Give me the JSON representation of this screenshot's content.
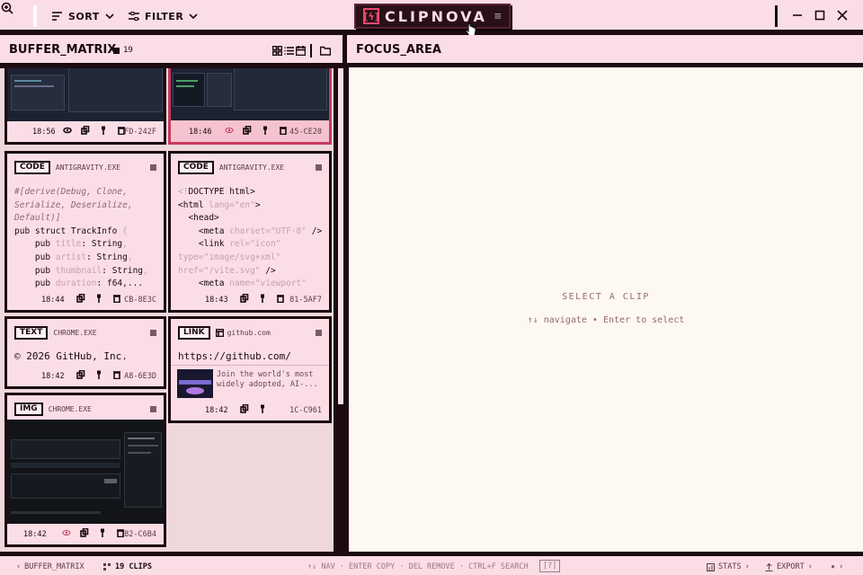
{
  "toolbar": {
    "sort_label": "SORT",
    "filter_label": "FILTER"
  },
  "logo": {
    "mark": "[ϟ]",
    "name": "CLIPNOVA"
  },
  "buffer": {
    "title": "BUFFER_MATRIX",
    "count": "19"
  },
  "focus": {
    "title": "FOCUS_AREA",
    "placeholder": "SELECT A CLIP",
    "hint": "↑↓ navigate • Enter to select"
  },
  "cards": [
    {
      "time": "18:56",
      "id": "FD-242F"
    },
    {
      "time": "18:46",
      "id": "45-CE20"
    },
    {
      "type": "CODE",
      "source": "ANTIGRAVITY.EXE",
      "time": "18:44",
      "id": "CB-8E3C"
    },
    {
      "type": "CODE",
      "source": "ANTIGRAVITY.EXE",
      "time": "18:43",
      "id": "81-5AF7"
    },
    {
      "type": "TEXT",
      "source": "CHROME.EXE",
      "content": "© 2026 GitHub, Inc.",
      "time": "18:42",
      "id": "A8-6E3D"
    },
    {
      "type": "LINK",
      "source": "github.com",
      "url": "https://github.com/",
      "preview": "Join the world's most widely adopted, AI-...",
      "time": "18:42",
      "id": "1C-C961"
    },
    {
      "type": "IMG",
      "source": "CHROME.EXE",
      "time": "18:42",
      "id": "B2-C6B4"
    }
  ],
  "rust_code": {
    "l1": "#[derive(Debug, Clone,",
    "l2": "Serialize, Deserialize,",
    "l3": "Default)]",
    "l4a": "pub struct TrackInfo ",
    "l4b": "{",
    "l5a": "    pub ",
    "l5b": "title",
    "l5c": ": String",
    "l5d": ",",
    "l6a": "    pub ",
    "l6b": "artist",
    "l6c": ": String",
    "l6d": ",",
    "l7a": "    pub ",
    "l7b": "thumbnail",
    "l7c": ": String",
    "l7d": ",",
    "l8a": "    pub ",
    "l8b": "duration",
    "l8c": ": f64,..."
  },
  "html_code": {
    "l1a": "<!",
    "l1b": "DOCTYPE html",
    "l1c": ">",
    "l2a": "<html ",
    "l2b": "lang=\"en\"",
    "l2c": ">",
    "l3": "  <head>",
    "l4a": "    <meta ",
    "l4b": "charset=\"UTF-8\"",
    "l4c": " />",
    "l5a": "    <link ",
    "l5b": "rel=\"icon\"",
    "l6": "type=\"image/svg+xml\"",
    "l7a": "href=\"/vite.svg\"",
    "l7b": " />",
    "l8a": "    <meta ",
    "l8b": "name=\"viewport\""
  },
  "statusbar": {
    "back": "BUFFER_MATRIX",
    "clips": "19 CLIPS",
    "shortcuts": "↑↓ NAV · ENTER COPY · DEL REMOVE · CTRL+F SEARCH",
    "help": "[?]",
    "stats": "STATS",
    "export": "EXPORT"
  },
  "colors": {
    "panel": "#fbdde6",
    "border": "#1a0a10",
    "accent": "#c8395e",
    "focus_bg": "#fdf9f0"
  }
}
